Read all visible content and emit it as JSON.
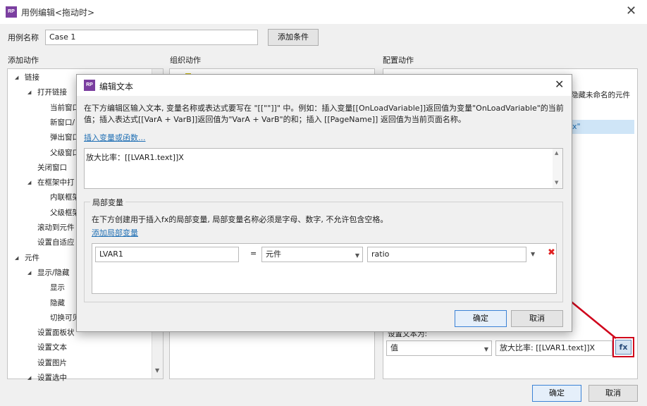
{
  "window": {
    "title": "用例编辑<拖动时>",
    "app_icon_text": "RP",
    "close_glyph": "✕"
  },
  "case_name": {
    "label": "用例名称",
    "value": "Case 1",
    "add_condition_button": "添加条件"
  },
  "sections": {
    "add_action": "添加动作",
    "organize_action": "组织动作",
    "configure_action": "配置动作"
  },
  "tree": [
    {
      "label": "链接",
      "level": 0,
      "expanded": true
    },
    {
      "label": "打开链接",
      "level": 1,
      "expanded": true
    },
    {
      "label": "当前窗口",
      "level": 2
    },
    {
      "label": "新窗口/",
      "level": 2
    },
    {
      "label": "弹出窗口",
      "level": 2
    },
    {
      "label": "父级窗口",
      "level": 2
    },
    {
      "label": "关闭窗口",
      "level": 1
    },
    {
      "label": "在框架中打",
      "level": 1,
      "expanded": true
    },
    {
      "label": "内联框架",
      "level": 2
    },
    {
      "label": "父级框架",
      "level": 2
    },
    {
      "label": "滚动到元件",
      "level": 1
    },
    {
      "label": "设置自适应",
      "level": 1
    },
    {
      "label": "元件",
      "level": 0,
      "expanded": true
    },
    {
      "label": "显示/隐藏",
      "level": 1,
      "expanded": true
    },
    {
      "label": "显示",
      "level": 2
    },
    {
      "label": "隐藏",
      "level": 2
    },
    {
      "label": "切换可见",
      "level": 2
    },
    {
      "label": "设置面板状",
      "level": 1
    },
    {
      "label": "设置文本",
      "level": 1
    },
    {
      "label": "设置图片",
      "level": 1
    },
    {
      "label": "设置选中",
      "level": 1,
      "expanded": true
    }
  ],
  "configure_panel": {
    "hide_unnamed": "隐藏未命名的元件",
    "partial_text": "x\"",
    "set_text_label": "设置文本为:",
    "value_type": "值",
    "value_text": "放大比率: [[LVAR1.text]]X",
    "fx_button": "fx"
  },
  "footer": {
    "ok": "确定",
    "cancel": "取消"
  },
  "dialog": {
    "title": "编辑文本",
    "icon_text": "RP",
    "close_glyph": "✕",
    "instructions": "在下方编辑区输入文本, 变量名称或表达式要写在 \"[[\"\"]]\" 中。例如：插入变量[[OnLoadVariable]]返回值为变量\"OnLoadVariable\"的当前值；插入表达式[[VarA + VarB]]返回值为\"VarA + VarB\"的和；插入 [[PageName]] 返回值为当前页面名称。",
    "insert_link": "插入变量或函数...",
    "editor_text": "放大比率：[[LVAR1.text]]X",
    "local_vars": {
      "group_title": "局部变量",
      "description": "在下方创建用于插入fx的局部变量, 局部变量名称必须是字母、数字, 不允许包含空格。",
      "add_link": "添加局部变量",
      "rows": [
        {
          "name": "LVAR1",
          "equals": "=",
          "type": "元件",
          "target": "ratio",
          "delete_glyph": "✖"
        }
      ]
    },
    "ok": "确定",
    "cancel": "取消"
  },
  "colors": {
    "accent_red": "#d0021b",
    "delete_red": "#e02020",
    "link_blue": "#1f6fb4",
    "app_purple": "#7b3fa0",
    "highlight_blue": "#cfe5f7"
  }
}
